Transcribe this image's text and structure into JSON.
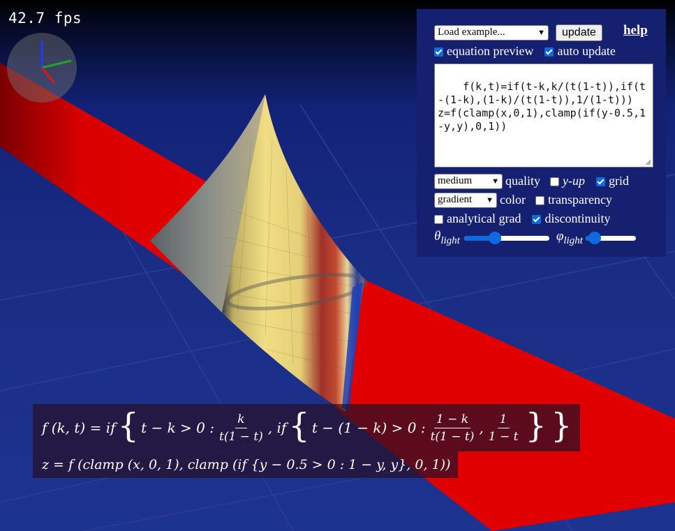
{
  "fps": "42.7 fps",
  "panel": {
    "example_select": "Load example...",
    "update_button": "update",
    "help_link": "help",
    "equation_preview": {
      "label": "equation preview",
      "checked": true
    },
    "auto_update": {
      "label": "auto update",
      "checked": true
    },
    "equation_text": "f(k,t)=if(t-k,k/(t(1-t)),if(t-(1-k),(1-k)/(t(1-t)),1/(1-t)))\nz=f(clamp(x,0,1),clamp(if(y-0.5,1-y,y),0,1))",
    "quality_select": "medium",
    "quality_label": "quality",
    "y_up": {
      "label": "y-up",
      "checked": false
    },
    "grid": {
      "label": "grid",
      "checked": true
    },
    "color_select": "gradient",
    "color_label": "color",
    "transparency": {
      "label": "transparency",
      "checked": false
    },
    "analytical_grad": {
      "label": "analytical grad",
      "checked": false
    },
    "discontinuity": {
      "label": "discontinuity",
      "checked": true
    },
    "theta_label": "θ",
    "theta_sub": "light",
    "theta_value": 0.36,
    "phi_label": "φ",
    "phi_sub": "light",
    "phi_value": 0.18
  },
  "math": {
    "line1": {
      "lhs": "f (k, t) = if",
      "cond1": "t − k > 0 :",
      "frac1_num": "k",
      "frac1_den": "t(1 − t)",
      "sep1": ", if",
      "cond2": "t − (1 − k) > 0 :",
      "frac2_num": "1 − k",
      "frac2_den": "t(1 − t)",
      "sep2": ",",
      "frac3_num": "1",
      "frac3_den": "1 − t"
    },
    "line2": "z = f (clamp (x, 0, 1), clamp (if {y − 0.5 > 0 : 1 − y, y}, 0, 1))"
  },
  "colors": {
    "background": "#1b2f86",
    "ribbon": "#e80000",
    "surface_light": "#e8d77e",
    "accent": "#0f6ae0"
  }
}
